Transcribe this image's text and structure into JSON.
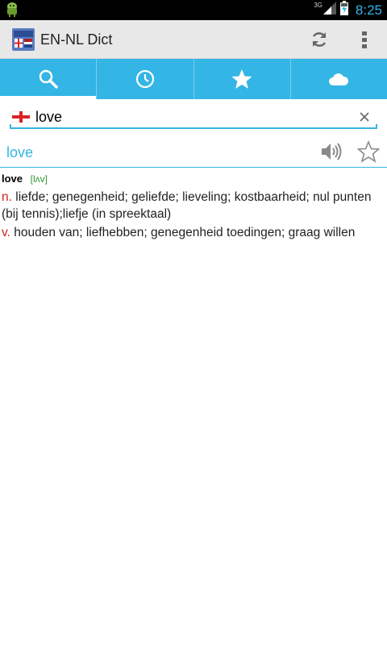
{
  "status_bar": {
    "network": "3G",
    "time": "8:25"
  },
  "action_bar": {
    "title": "EN-NL Dict"
  },
  "tabs": [
    {
      "icon": "search-icon",
      "active": true
    },
    {
      "icon": "history-clock-icon",
      "active": false
    },
    {
      "icon": "star-icon",
      "active": false
    },
    {
      "icon": "cloud-icon",
      "active": false
    }
  ],
  "search": {
    "value": "love",
    "language_flag": "english-flag-icon"
  },
  "entry": {
    "word": "love",
    "headword": "love",
    "phonetic": "[lʌv]",
    "senses": [
      {
        "pos": "n.",
        "text": " liefde; genegenheid; geliefde; lieveling; kostbaarheid; nul punten (bij tennis);liefje (in spreektaal)"
      },
      {
        "pos": "v.",
        "text": " houden van; liefhebben; genegenheid toedingen; graag willen"
      }
    ]
  },
  "colors": {
    "accent": "#33b5e5",
    "pos": "#cc1f1f",
    "phonetic": "#2f9a2f",
    "action_bar_bg": "#e8e8e8"
  }
}
